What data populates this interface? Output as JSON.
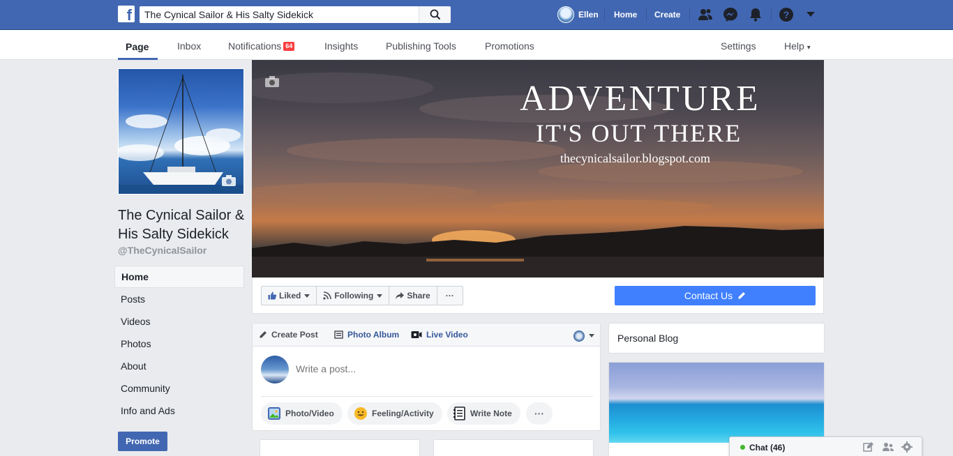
{
  "topbar": {
    "logo": "f",
    "search_value": "The Cynical Sailor & His Salty Sidekick",
    "user_name": "Ellen",
    "home_label": "Home",
    "create_label": "Create",
    "icons": [
      "friends-icon",
      "messenger-icon",
      "notifications-icon",
      "help-icon",
      "account-menu-icon"
    ],
    "brand_color": "#4267b2"
  },
  "subnav": {
    "items": [
      {
        "label": "Page"
      },
      {
        "label": "Inbox"
      },
      {
        "label": "Notifications",
        "badge": "64"
      },
      {
        "label": "Insights"
      },
      {
        "label": "Publishing Tools"
      },
      {
        "label": "Promotions"
      }
    ],
    "settings": "Settings",
    "help": "Help",
    "help_caret": "▾"
  },
  "page": {
    "name": "The Cynical Sailor & His Salty Sidekick",
    "handle": "@TheCynicalSailor"
  },
  "left_menu": [
    "Home",
    "Posts",
    "Videos",
    "Photos",
    "About",
    "Community",
    "Info and Ads"
  ],
  "promote_label": "Promote",
  "cover": {
    "title": "ADVENTURE",
    "subtitle": "IT'S OUT THERE",
    "url": "thecynicalsailor.blogspot.com"
  },
  "actions": {
    "liked": "Liked",
    "following": "Following",
    "share": "Share",
    "more": "···",
    "contact": "Contact Us"
  },
  "composer": {
    "tabs": [
      "Create Post",
      "Photo Album",
      "Live Video"
    ],
    "placeholder": "Write a post...",
    "buttons": [
      "Photo/Video",
      "Feeling/Activity",
      "Write Note"
    ],
    "more": "···"
  },
  "right_column": {
    "blog_title": "Personal Blog"
  },
  "chat": {
    "label": "Chat (46)",
    "status_color": "#42b72a"
  }
}
